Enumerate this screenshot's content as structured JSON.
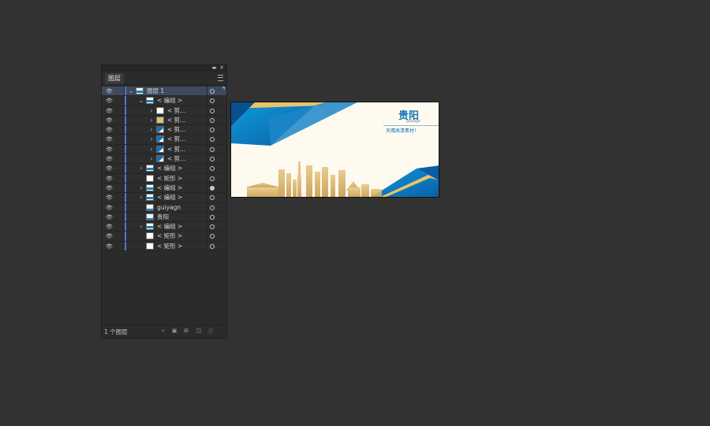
{
  "panel": {
    "title": "图层",
    "footer_count": "1 个图层",
    "collapse_icon": "double-arrow-icon",
    "close_icon": "close-icon"
  },
  "layers": [
    {
      "label": "图层 1",
      "visible": true,
      "expanded": true,
      "indent": 0,
      "thumb": "waves",
      "selected": true
    },
    {
      "label": "< 编组 >",
      "visible": true,
      "expanded": true,
      "indent": 1,
      "thumb": "waves"
    },
    {
      "label": "< 剪...",
      "visible": true,
      "expanded": false,
      "indent": 2,
      "thumb": "blank"
    },
    {
      "label": "< 剪...",
      "visible": true,
      "expanded": false,
      "indent": 2,
      "thumb": "gold"
    },
    {
      "label": "< 剪...",
      "visible": true,
      "expanded": false,
      "indent": 2,
      "thumb": "blue"
    },
    {
      "label": "< 剪...",
      "visible": true,
      "expanded": false,
      "indent": 2,
      "thumb": "blue"
    },
    {
      "label": "< 剪...",
      "visible": true,
      "expanded": false,
      "indent": 2,
      "thumb": "blue"
    },
    {
      "label": "< 剪...",
      "visible": true,
      "expanded": false,
      "indent": 2,
      "thumb": "blue"
    },
    {
      "label": "< 编组 >",
      "visible": true,
      "expanded": false,
      "indent": 1,
      "thumb": "waves"
    },
    {
      "label": "< 矩形 >",
      "visible": true,
      "expanded": null,
      "indent": 1,
      "thumb": "blank"
    },
    {
      "label": "< 编组 >",
      "visible": true,
      "expanded": false,
      "indent": 1,
      "thumb": "waves"
    },
    {
      "label": "< 编组 >",
      "visible": true,
      "expanded": false,
      "indent": 1,
      "thumb": "waves"
    },
    {
      "label": "guiyagn",
      "visible": true,
      "expanded": null,
      "indent": 1,
      "thumb": "text"
    },
    {
      "label": "贵阳",
      "visible": true,
      "expanded": null,
      "indent": 1,
      "thumb": "text"
    },
    {
      "label": "< 编组 >",
      "visible": true,
      "expanded": false,
      "indent": 1,
      "thumb": "waves"
    },
    {
      "label": "< 矩形 >",
      "visible": true,
      "expanded": null,
      "indent": 1,
      "thumb": "blank"
    },
    {
      "label": "< 矩形 >",
      "visible": true,
      "expanded": null,
      "indent": 1,
      "thumb": "blank"
    }
  ],
  "footer_buttons": [
    "search-icon",
    "clip-icon",
    "new-sublayer-icon",
    "new-layer-icon",
    "trash-icon"
  ],
  "artboard": {
    "title": "贵阳",
    "subtitle": "guiyagn",
    "tagline": "天鹰高清素材！",
    "colors": {
      "blue": "#1976b6",
      "gold": "#d7a94f",
      "background": "#fffaf0"
    }
  }
}
